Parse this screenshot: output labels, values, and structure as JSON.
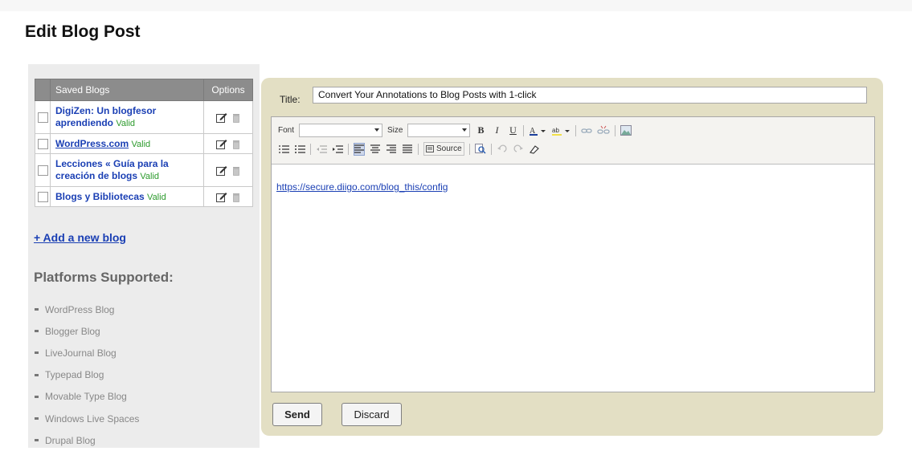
{
  "page": {
    "title": "Edit Blog Post"
  },
  "blogs_table": {
    "headers": {
      "name": "Saved Blogs",
      "options": "Options"
    },
    "rows": [
      {
        "name": "DigiZen: Un blogfesor aprendiendo",
        "status": "Valid"
      },
      {
        "name": "WordPress.com",
        "status": "Valid"
      },
      {
        "name": "Lecciones « Guía para la creación de blogs",
        "status": "Valid"
      },
      {
        "name": "Blogs y Bibliotecas",
        "status": "Valid"
      }
    ]
  },
  "add_blog_link": "+ Add a new blog",
  "platforms": {
    "title": "Platforms Supported:",
    "items": [
      "WordPress Blog",
      "Blogger Blog",
      "LiveJournal Blog",
      "Typepad Blog",
      "Movable Type Blog",
      "Windows Live Spaces",
      "Drupal Blog"
    ]
  },
  "editor": {
    "title_label": "Title:",
    "title_value": "Convert Your Annotations to Blog Posts with 1-click",
    "toolbar": {
      "font_label": "Font",
      "size_label": "Size",
      "source_label": "Source",
      "icons": [
        "bold-icon",
        "italic-icon",
        "underline-icon",
        "text-color-icon",
        "background-color-icon",
        "link-icon",
        "unlink-icon",
        "image-icon",
        "numbered-list-icon",
        "bulleted-list-icon",
        "outdent-icon",
        "indent-icon",
        "align-left-icon",
        "align-center-icon",
        "align-right-icon",
        "justify-icon",
        "source-icon",
        "find-icon",
        "undo-icon",
        "redo-icon",
        "eraser-icon"
      ]
    },
    "body_link": "https://secure.diigo.com/blog_this/config"
  },
  "buttons": {
    "send": "Send",
    "discard": "Discard"
  },
  "colors": {
    "accent_link": "#1a3fb4",
    "valid": "#2c9a2c",
    "panel_bg": "#e3dfc4",
    "header_gray": "#8c8c8c"
  }
}
